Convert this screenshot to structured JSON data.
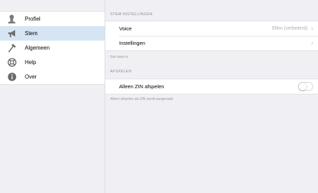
{
  "sidebar": {
    "items": [
      {
        "label": "Profiel",
        "icon": "person-icon"
      },
      {
        "label": "Stem",
        "icon": "megaphone-icon"
      },
      {
        "label": "Algemeen",
        "icon": "hammer-icon"
      },
      {
        "label": "Help",
        "icon": "lifebuoy-icon"
      },
      {
        "label": "Over",
        "icon": "info-icon"
      }
    ],
    "active_index": 1
  },
  "main": {
    "voice_section": {
      "header": "STEM INSTELLINGEN",
      "rows": [
        {
          "label": "Voice",
          "value": "Ellen (verbeterd)"
        },
        {
          "label": "Instellingen",
          "value": ""
        }
      ],
      "footer": "Stel stem in"
    },
    "play_section": {
      "header": "AFSPELEN",
      "toggle_label": "Alleen ZIN afspelen",
      "toggle_on": false,
      "footer": "Alleen afspelen als ZIN wordt aangeraakt"
    }
  },
  "colors": {
    "background": "#efeff4",
    "active_row": "#d5e5f4",
    "secondary_text": "#8e8e93"
  }
}
